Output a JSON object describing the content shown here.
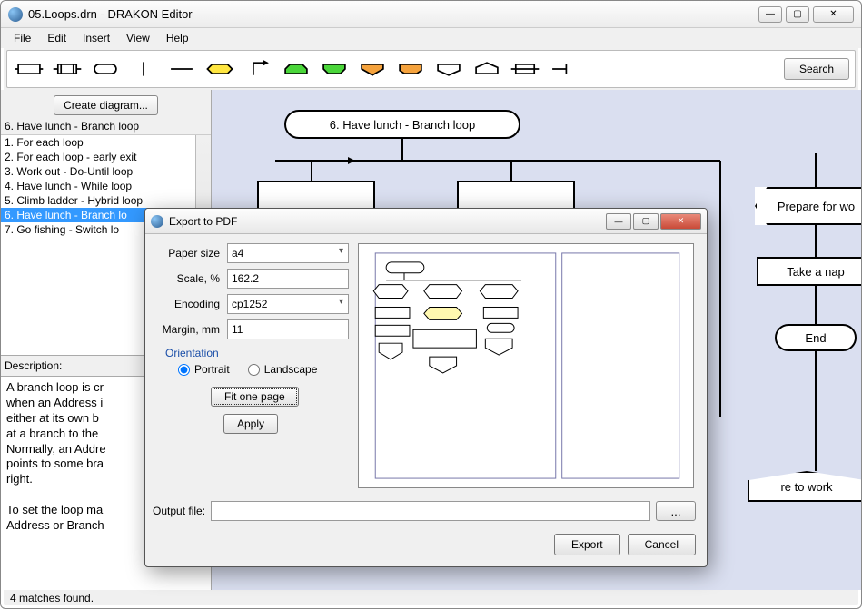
{
  "window": {
    "title": "05.Loops.drn - DRAKON Editor"
  },
  "menu": {
    "file": "File",
    "edit": "Edit",
    "insert": "Insert",
    "view": "View",
    "help": "Help"
  },
  "toolbar": {
    "search": "Search"
  },
  "sidebar": {
    "create": "Create diagram...",
    "header": "6. Have lunch - Branch loop",
    "items": [
      "1. For each loop",
      "2. For each loop - early exit",
      "3. Work out - Do-Until loop",
      "4. Have lunch - While loop",
      "5. Climb ladder - Hybrid loop",
      "6. Have lunch - Branch lo",
      "7. Go fishing - Switch lo"
    ],
    "selectedIndex": 5,
    "descLabel": "Description:",
    "description": "A branch loop is cr\nwhen an Address i\neither at its own b\nat a branch to the\nNormally, an Addre\npoints to some bra\nright.\n\nTo set the loop ma\nAddress or Branch"
  },
  "canvas": {
    "title": "6. Have lunch - Branch loop",
    "right1": "Prepare for wo",
    "right2": "Take a nap",
    "right3": "End",
    "right4": "re to work"
  },
  "dialog": {
    "title": "Export to PDF",
    "paperSizeLabel": "Paper size",
    "paperSize": "a4",
    "scaleLabel": "Scale, %",
    "scale": "162.2",
    "encodingLabel": "Encoding",
    "encoding": "cp1252",
    "marginLabel": "Margin, mm",
    "margin": "11",
    "orientationLabel": "Orientation",
    "portrait": "Portrait",
    "landscape": "Landscape",
    "fit": "Fit one page",
    "apply": "Apply",
    "outputLabel": "Output file:",
    "browse": "...",
    "export": "Export",
    "cancel": "Cancel"
  },
  "status": "4 matches found."
}
